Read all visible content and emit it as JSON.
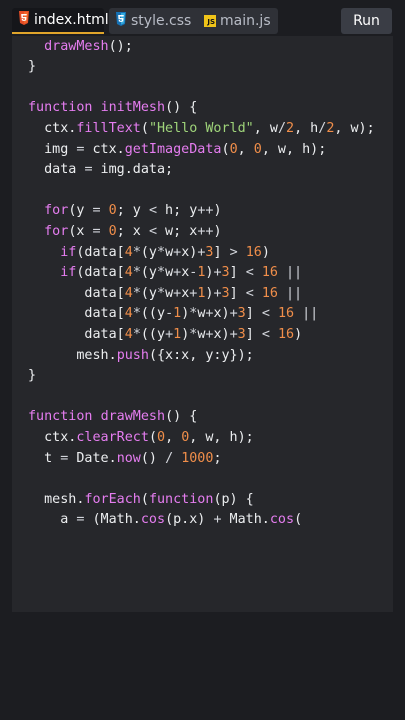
{
  "tabs": [
    {
      "label": "index.html",
      "icon": "html5-icon",
      "active": true
    },
    {
      "label": "style.css",
      "icon": "css3-icon",
      "active": false
    },
    {
      "label": "main.js",
      "icon": "js-icon",
      "active": false
    }
  ],
  "run_label": "Run",
  "js_badge": "JS",
  "code_lines": [
    "  drawMesh();",
    "}",
    "",
    "function initMesh() {",
    "  ctx.fillText(\"Hello World\", w/2, h/2, w);",
    "  img = ctx.getImageData(0, 0, w, h);",
    "  data = img.data;",
    "",
    "  for(y = 0; y < h; y++)",
    "  for(x = 0; x < w; x++)",
    "    if(data[4*(y*w+x)+3] > 16)",
    "    if(data[4*(y*w+x-1)+3] < 16 ||",
    "       data[4*(y*w+x+1)+3] < 16 ||",
    "       data[4*((y-1)*w+x)+3] < 16 ||",
    "       data[4*((y+1)*w+x)+3] < 16)",
    "      mesh.push({x:x, y:y});",
    "}",
    "",
    "function drawMesh() {",
    "  ctx.clearRect(0, 0, w, h);",
    "  t = Date.now() / 1000;",
    "",
    "  mesh.forEach(function(p) {",
    "    a = (Math.cos(p.x) + Math.cos("
  ],
  "colors": {
    "keyword": "#e57df0",
    "string": "#9fd47a",
    "number": "#f08e4a",
    "text": "#eceef0",
    "active_tab_underline": "#e0a52b",
    "editor_bg": "#26272b",
    "page_bg": "#1c1d21"
  }
}
